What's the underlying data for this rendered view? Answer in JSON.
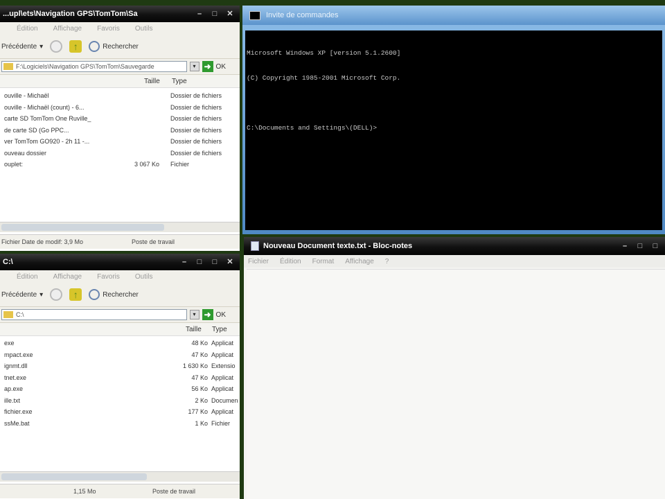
{
  "colors": {
    "desktop": "#1f3a12",
    "title_dark": "#111111",
    "title_blue": "#6fa0d2",
    "explorer_bg": "#f1f0ea",
    "console_bg": "#000000"
  },
  "explorer_top": {
    "title": "...upl\\ets\\Navigation GPS\\TomTom\\Sa",
    "menu": [
      "Édition",
      "Affichage",
      "Favoris",
      "Outils"
    ],
    "back_label": "Précédente",
    "search_label": "Rechercher",
    "address": "F:\\Logiciels\\Navigation GPS\\TomTom\\Sauvegarde",
    "go_label": "OK",
    "columns": {
      "name": "",
      "size": "Taille",
      "type": "Type"
    },
    "rows": [
      {
        "name": "ouville - Michaël",
        "size": "",
        "type": "Dossier de fichiers"
      },
      {
        "name": "ouville - Michaël (count) - 6...",
        "size": "",
        "type": "Dossier de fichiers"
      },
      {
        "name": "carte SD TomTom One Ruville_",
        "size": "",
        "type": "Dossier de fichiers"
      },
      {
        "name": "de carte SD (Go PPC...",
        "size": "",
        "type": "Dossier de fichiers"
      },
      {
        "name": "ver TomTom GO920 - 2h 11 -...",
        "size": "",
        "type": "Dossier de fichiers"
      },
      {
        "name": "ouveau dossier",
        "size": "",
        "type": "Dossier de fichiers"
      },
      {
        "name": "ouplet:",
        "size": "3 067 Ko",
        "type": "Fichier"
      }
    ],
    "status_left": "Fichier Date de modif: 3,9 Mo",
    "status_right": "Poste de travail"
  },
  "explorer_bottom": {
    "title": "C:\\",
    "menu": [
      "Édition",
      "Affichage",
      "Favoris",
      "Outils"
    ],
    "back_label": "Précédente",
    "search_label": "Rechercher",
    "address": "C:\\",
    "go_label": "OK",
    "columns": {
      "name": "",
      "size": "Taille",
      "type": "Type"
    },
    "rows": [
      {
        "name": "exe",
        "size": "48 Ko",
        "type": "Applicat"
      },
      {
        "name": "mpact.exe",
        "size": "47 Ko",
        "type": "Applicat"
      },
      {
        "name": "ignmt.dll",
        "size": "1 630 Ko",
        "type": "Extensio"
      },
      {
        "name": "tnet.exe",
        "size": "47 Ko",
        "type": "Applicat"
      },
      {
        "name": "ap.exe",
        "size": "56 Ko",
        "type": "Applicat"
      },
      {
        "name": "ille.txt",
        "size": "2 Ko",
        "type": "Documen"
      },
      {
        "name": "fichier.exe",
        "size": "177 Ko",
        "type": "Applicat"
      },
      {
        "name": "ssMe.bat",
        "size": "1 Ko",
        "type": "Fichier"
      }
    ],
    "status_left": "1,15 Mo",
    "status_right": "Poste de travail"
  },
  "console": {
    "title": "Invite de commandes",
    "lines": [
      "Microsoft Windows XP [version 5.1.2600]",
      "(C) Copyright 1985-2001 Microsoft Corp.",
      "",
      "C:\\Documents and Settings\\(DELL)>"
    ]
  },
  "notepad": {
    "title": "Nouveau Document texte.txt - Bloc-notes",
    "menu": [
      "Fichier",
      "Édition",
      "Format",
      "Affichage",
      "?"
    ]
  }
}
